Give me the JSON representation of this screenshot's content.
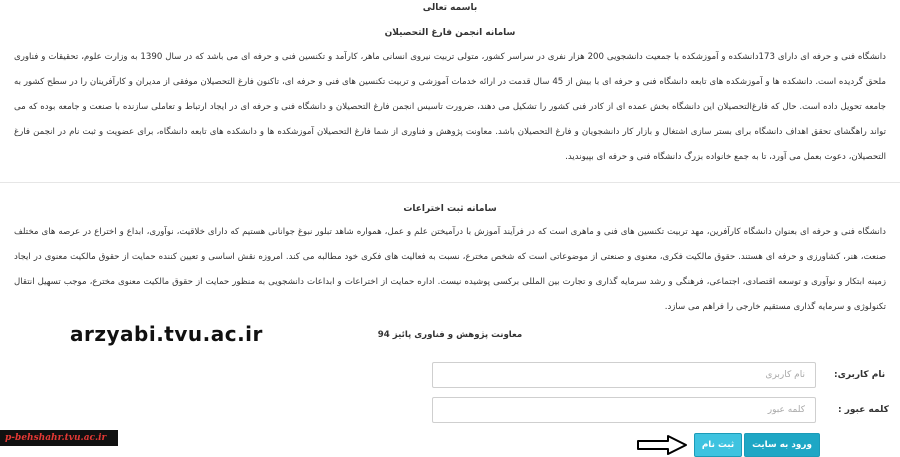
{
  "top": {
    "title": "باسمه تعالی"
  },
  "section1": {
    "title": "سامانه انجمن فارغ التحصیلان",
    "body": "دانشگاه فنی و حرفه ای دارای 173دانشکده و آموزشکده با جمعیت دانشجویی 200 هزار نفری در سراسر کشور، متولی تربیت نیروی انسانی ماهر، کارآمد و تکنسین فنی و حرفه ای می باشد که در سال 1390 به وزارت علوم، تحقیقات و فناوری ملحق گردیده است. دانشکده ها و آموزشکده های تابعه دانشگاه فنی و حرفه ای با بیش از 45 سال قدمت در ارائه خدمات آموزشی و تربیت تکنسین های فنی و حرفه ای، تاکنون فارغ التحصیلان موفقی از مدیران و کارآفرینان را در سطح کشور به جامعه تحویل داده است. حال که فارغ‌التحصیلان این دانشگاه بخش عمده ای از کادر فنی کشور را تشکیل می دهند، ضرورت تاسیس انجمن فارغ التحصیلان و دانشگاه فنی و حرفه ای در ایجاد ارتباط و تعاملی سازنده با صنعت و جامعه بوده که می تواند راهگشای تحقق اهداف دانشگاه برای بستر سازی اشتغال و بازار کار دانشجویان و فارغ التحصیلان باشد. معاونت پژوهش و فناوری از شما فارغ التحصیلان آموزشکده ها و دانشکده های تابعه دانشگاه، برای عضویت و ثبت نام در انجمن فارغ التحصیلان، دعوت بعمل می آورد، تا به جمع خانواده بزرگ دانشگاه فنی و حرفه ای بپیوندید."
  },
  "section2": {
    "title": "سامانه ثبت اختراعات",
    "body": "دانشگاه فنی و حرفه ای بعنوان دانشگاه کارآفرین، مهد تربیت تکنسین های فنی و ماهری است که در فرآیند آموزش با درآمیختن علم و عمل، همواره شاهد تبلور نبوغ جوانانی هستیم که دارای خلاقیت، نوآوری، ابداع و اختراع در عرصه های مختلف صنعت، هنر، کشاورزی و حرفه ای هستند. حقوق مالکیت فکری، معنوی و صنعتی از موضوعاتی است که شخص مخترع، نسبت به فعالیت های فکری خود مطالبه می کند. امروزه نقش اساسی و تعیین کننده حمایت از حقوق مالکیت معنوی در ایجاد زمینه ابتکار و نوآوری و توسعه اقتصادی، اجتماعی، فرهنگی و رشد سرمایه گذاری و تجارت بین المللی برکسی پوشیده نیست. اداره حمایت از اختراعات و ابداعات دانشجویی به منظور حمایت از حقوق مالکیت معنوی مخترع، موجب تسهیل انتقال تکنولوژی و سرمایه گذاری مستقیم خارجی را فراهم می سازد.",
    "credit": "معاونت پژوهش و فناوری پائیز 94"
  },
  "overlay": {
    "url": "arzyabi.tvu.ac.ir",
    "badge": "p-behshahr.tvu.ac.ir"
  },
  "form": {
    "username_label": "نام کاربری:",
    "username_placeholder": "نام کاربری",
    "password_label": "کلمه عبور :",
    "password_placeholder": "کلمه عبور",
    "login_label": "ورود به سایت",
    "register_label": "ثبت نام"
  },
  "colors": {
    "login_button": "#1ea7c5",
    "register_button": "#3ec3e0",
    "badge_text": "#e53935"
  },
  "icons": {
    "pointer_arrow": "arrow-right-outline-icon"
  }
}
